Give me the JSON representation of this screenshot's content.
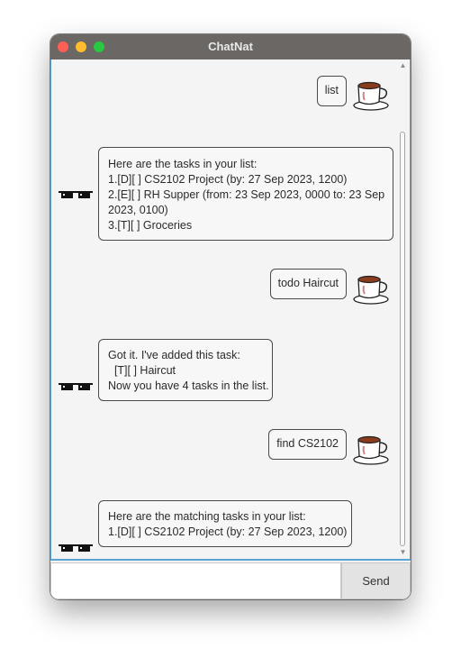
{
  "window": {
    "title": "ChatNat"
  },
  "messages": [
    {
      "from": "user",
      "lines": [
        "list"
      ],
      "avatar": "coffee-cup-icon"
    },
    {
      "from": "bot",
      "lines": [
        "Here are the tasks in your list:",
        "1.[D][ ] CS2102 Project (by: 27 Sep 2023, 1200)",
        "2.[E][ ] RH Supper (from: 23 Sep 2023, 0000 to: 23 Sep",
        "2023, 0100)",
        "3.[T][ ] Groceries"
      ],
      "avatar": "pixel-sunglasses-icon"
    },
    {
      "from": "user",
      "lines": [
        "todo Haircut"
      ],
      "avatar": "coffee-cup-icon"
    },
    {
      "from": "bot",
      "lines": [
        "Got it. I've added this task:",
        "  [T][ ] Haircut",
        "Now you have 4 tasks in the list."
      ],
      "avatar": "pixel-sunglasses-icon"
    },
    {
      "from": "user",
      "lines": [
        "find CS2102"
      ],
      "avatar": "coffee-cup-icon"
    },
    {
      "from": "bot",
      "lines": [
        "Here are the matching tasks in your list:",
        "1.[D][ ] CS2102 Project (by: 27 Sep 2023, 1200)"
      ],
      "avatar": "pixel-sunglasses-icon"
    }
  ],
  "input": {
    "value": "",
    "placeholder": ""
  },
  "send_button": {
    "label": "Send"
  }
}
